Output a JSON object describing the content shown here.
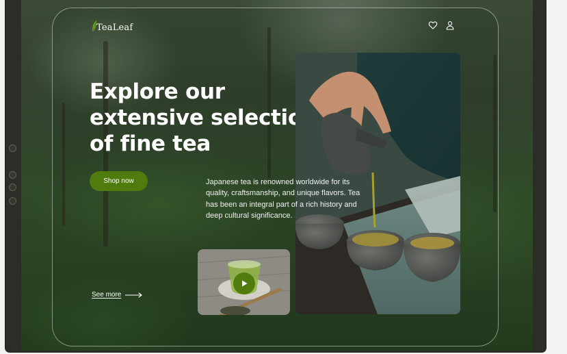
{
  "brand": {
    "name": "TeaLeaf",
    "accent_color": "#4f7c0d"
  },
  "header": {
    "icons": [
      "heart-icon",
      "user-icon"
    ]
  },
  "hero": {
    "title": "Explore our extensive selection of fine tea",
    "cta_label": "Shop now",
    "description": "Japanese tea is renowned worldwide for its quality, craftsmanship, and unique flavors. Tea has been an integral part of a rich history and deep cultural significance.",
    "see_more_label": "See more"
  },
  "media": {
    "main_photo": "tea-pouring-photo",
    "video_thumbnail": "green-tea-cup-video",
    "play_icon": "play-icon"
  }
}
